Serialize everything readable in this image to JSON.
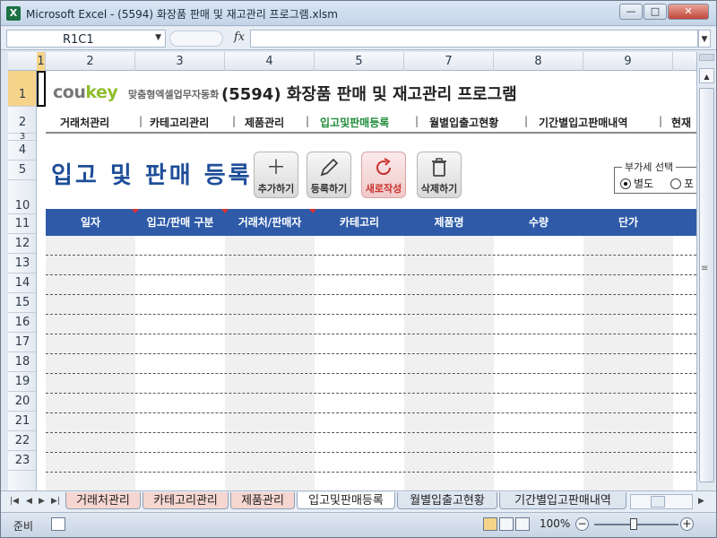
{
  "window": {
    "title": "Microsoft Excel - (5594) 화장품 판매 및 재고관리 프로그램.xlsm",
    "app_icon": "X",
    "controls": {
      "minimize": "—",
      "maximize": "□",
      "close": "✕"
    }
  },
  "formula_bar": {
    "name_box": "R1C1",
    "fx_label": "fx",
    "formula": ""
  },
  "columns": [
    "1",
    "2",
    "3",
    "4",
    "5",
    "7",
    "8",
    "9"
  ],
  "rows": [
    "1",
    "2",
    "3",
    "4",
    "5",
    "10",
    "11",
    "12",
    "13",
    "14",
    "15",
    "16",
    "17",
    "18",
    "19",
    "20",
    "21",
    "22",
    "23"
  ],
  "sheet": {
    "logo_cou": "cou",
    "logo_key": "key",
    "logo_sub": "맞춤형엑셀업무자동화",
    "title": "(5594) 화장품 판매 및 재고관리 프로그램",
    "nav": [
      "거래처관리",
      "카테고리관리",
      "제품관리",
      "입고및판매등록",
      "월별입출고현황",
      "기간별입고판매내역",
      "현재"
    ],
    "nav_active_index": 3,
    "heading": "입고 및 판매 등록",
    "buttons": {
      "add": "추가하기",
      "register": "등록하기",
      "refresh": "새로작성",
      "delete": "삭제하기"
    },
    "vat": {
      "legend": "부가세 선택",
      "option_separate": "별도",
      "option_included": "포",
      "selected": "별도"
    },
    "table_headers": [
      "일자",
      "입고/판매 구분",
      "거래처/판매자",
      "카테고리",
      "제품명",
      "수량",
      "단가"
    ],
    "required_columns": [
      "일자",
      "입고/판매 구분",
      "거래처/판매자"
    ],
    "rows": [
      [],
      [],
      [],
      [],
      [],
      [],
      [],
      [],
      [],
      [],
      [],
      [],
      []
    ]
  },
  "sheet_tabs": [
    "거래처관리",
    "카테고리관리",
    "제품관리",
    "입고및판매등록",
    "월별입출고현황",
    "기간별입고판매내역"
  ],
  "active_sheet_tab": "입고및판매등록",
  "status_bar": {
    "ready": "준비",
    "zoom": "100%",
    "zoom_out": "−",
    "zoom_in": "+"
  },
  "colors": {
    "table_header": "#2e5aa8",
    "heading": "#1f4e99",
    "nav_active": "#1e8c3a",
    "logo_key": "#8fbd2d",
    "refresh_button": "#c9302c"
  }
}
